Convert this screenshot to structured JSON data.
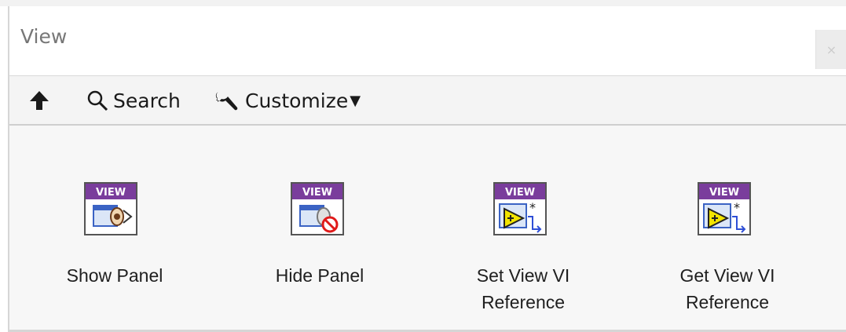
{
  "window": {
    "title": "View",
    "close_glyph": "×"
  },
  "toolbar": {
    "up_icon": "up-arrow-icon",
    "search_label": "Search",
    "customize_label": "Customize",
    "customize_caret": "▼"
  },
  "items": [
    {
      "label": "Show Panel",
      "badge": "VIEW",
      "icon": "show-panel-icon"
    },
    {
      "label": "Hide Panel",
      "badge": "VIEW",
      "icon": "hide-panel-icon"
    },
    {
      "label": "Set View VI Reference",
      "badge": "VIEW",
      "icon": "set-view-vi-reference-icon"
    },
    {
      "label": "Get View VI Reference",
      "badge": "VIEW",
      "icon": "get-view-vi-reference-icon"
    }
  ],
  "colors": {
    "badge": "#7a3d9c",
    "accent_yellow": "#f2e400",
    "accent_blue": "#2f4fd6",
    "stop_red": "#e01b1b"
  }
}
